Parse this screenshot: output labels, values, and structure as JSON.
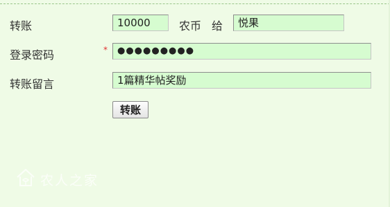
{
  "form": {
    "transfer_label": "转账",
    "amount_value": "10000",
    "currency_text": "农币",
    "to_text": "给",
    "recipient_value": "悦果",
    "password_label": "登录密码",
    "password_required_mark": "*",
    "password_value": "●●●●●●●●●",
    "message_label": "转账留言",
    "message_value": "1篇精华帖奖励",
    "submit_label": "转账"
  },
  "watermark": {
    "logo_icon": "house-logo-icon"
  },
  "colors": {
    "page_background": "#effbe6",
    "input_background": "#d6fcd0",
    "required_mark": "#e03131"
  }
}
